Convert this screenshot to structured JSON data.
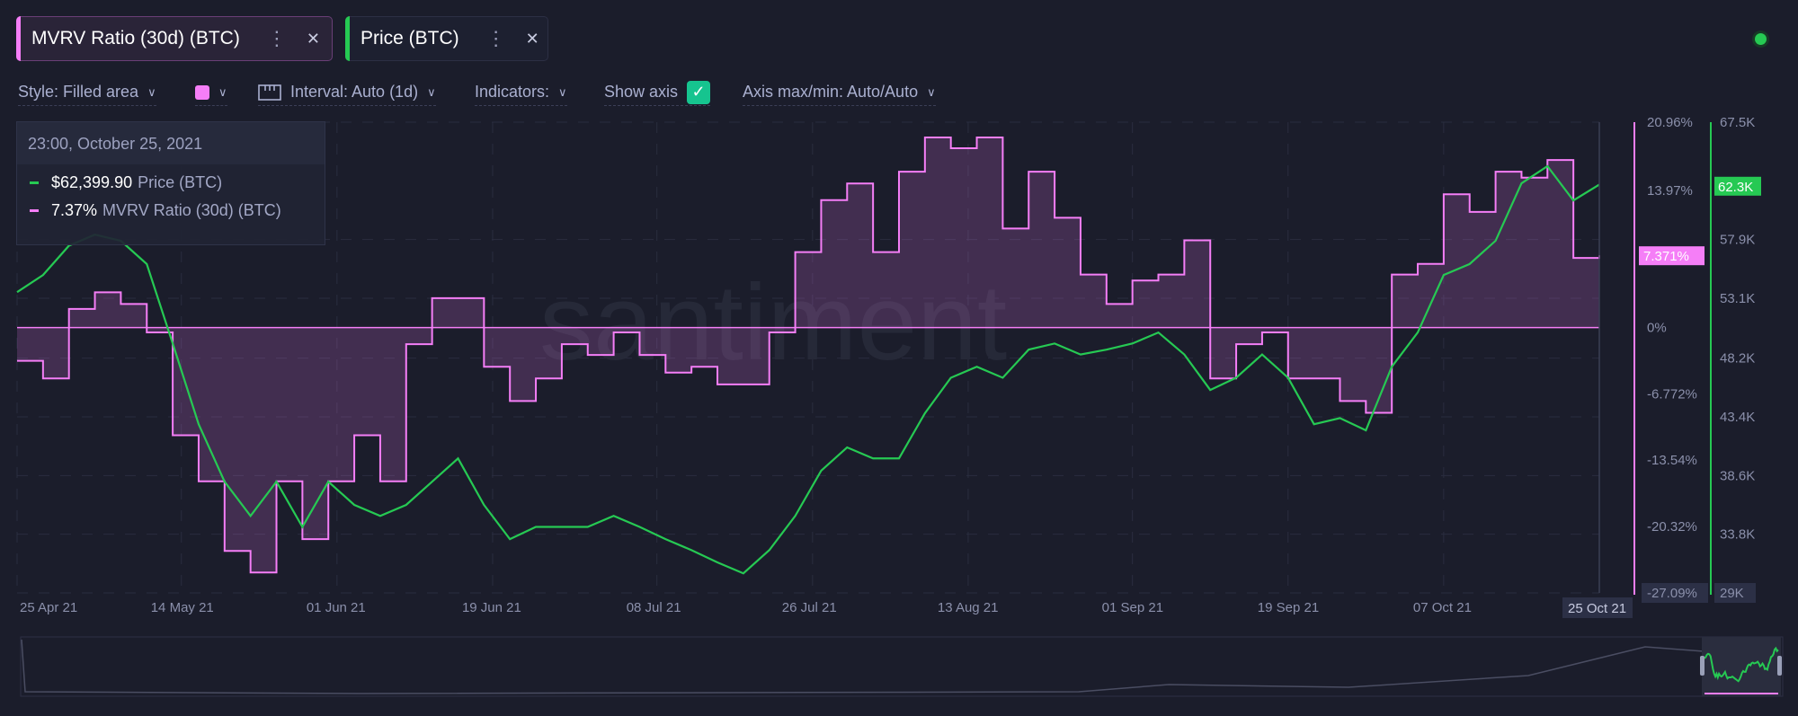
{
  "tabs": [
    {
      "label": "MVRV Ratio (30d) (BTC)",
      "color": "#f57ef7"
    },
    {
      "label": "Price (BTC)",
      "color": "#26c953"
    }
  ],
  "toolbar": {
    "style": "Style: Filled area",
    "interval": "Interval: Auto (1d)",
    "indicators": "Indicators:",
    "show_axis": "Show axis",
    "show_axis_checked": true,
    "axis_maxmin": "Axis max/min: Auto/Auto",
    "series_color": "#f57ef7"
  },
  "tooltip": {
    "date": "23:00, October 25, 2021",
    "rows": [
      {
        "value": "$62,399.90",
        "name": "Price (BTC)",
        "color": "#26c953"
      },
      {
        "value": "7.37%",
        "name": "MVRV Ratio (30d) (BTC)",
        "color": "#f57ef7"
      }
    ]
  },
  "watermark": "santiment",
  "chart_data": {
    "type": "line",
    "start_date": "2021-04-25",
    "step_days": 3,
    "series": [
      {
        "name": "MVRV Ratio (30d) (BTC)",
        "style": "filled-area-step",
        "color": "#f57ef7",
        "unit": "%",
        "values": [
          -3.4,
          -5.2,
          1.9,
          3.6,
          2.4,
          -0.5,
          -11,
          -15.7,
          -22.8,
          -25,
          -15.7,
          -21.6,
          -15.7,
          -11,
          -15.7,
          -1.7,
          3,
          3,
          -4,
          -7.5,
          -5.2,
          -1.7,
          -2.8,
          -0.5,
          -2.8,
          -4.6,
          -4,
          -5.8,
          -5.8,
          -0.5,
          7.7,
          13,
          14.7,
          7.7,
          15.9,
          19.4,
          18.3,
          19.4,
          10.1,
          15.9,
          11.2,
          5.4,
          2.4,
          4.8,
          5.4,
          8.9,
          -5.2,
          -1.7,
          -0.5,
          -5.2,
          -5.2,
          -7.5,
          -8.7,
          5.4,
          6.5,
          13.6,
          11.8,
          15.9,
          15.3,
          17.1,
          7.1,
          7.37
        ]
      },
      {
        "name": "Price (BTC)",
        "style": "line",
        "color": "#26c953",
        "unit": "USD K",
        "values": [
          53.6,
          55.0,
          57.4,
          58.3,
          57.8,
          55.9,
          49.4,
          42.8,
          38.1,
          35.3,
          38.1,
          34.4,
          38.1,
          36.2,
          35.3,
          36.2,
          38.1,
          40.0,
          36.2,
          33.4,
          34.4,
          34.4,
          34.4,
          35.3,
          34.4,
          33.4,
          32.5,
          31.5,
          30.6,
          32.5,
          35.3,
          39.0,
          40.9,
          40.0,
          40.0,
          43.7,
          46.6,
          47.5,
          46.6,
          48.9,
          49.4,
          48.5,
          48.9,
          49.4,
          50.3,
          48.5,
          45.6,
          46.6,
          48.5,
          46.6,
          42.8,
          43.3,
          42.3,
          47.5,
          50.3,
          55.0,
          55.9,
          57.8,
          62.5,
          63.9,
          61.1,
          62.4
        ]
      }
    ],
    "x_ticks": [
      {
        "label": "25 Apr 21",
        "day": 0
      },
      {
        "label": "14 May 21",
        "day": 19
      },
      {
        "label": "01 Jun 21",
        "day": 37
      },
      {
        "label": "19 Jun 21",
        "day": 55
      },
      {
        "label": "08 Jul 21",
        "day": 74
      },
      {
        "label": "26 Jul 21",
        "day": 92
      },
      {
        "label": "13 Aug 21",
        "day": 110
      },
      {
        "label": "01 Sep 21",
        "day": 129
      },
      {
        "label": "19 Sep 21",
        "day": 147
      },
      {
        "label": "07 Oct 21",
        "day": 165
      }
    ],
    "x_cursor": {
      "label": "25 Oct 21",
      "day": 183
    },
    "y_left": {
      "range": [
        -27.09,
        20.96
      ],
      "ticks": [
        {
          "label": "20.96%",
          "v": 20.96
        },
        {
          "label": "13.97%",
          "v": 13.97
        },
        {
          "label": "0%",
          "v": 0
        },
        {
          "label": "-6.772%",
          "v": -6.772
        },
        {
          "label": "-13.54%",
          "v": -13.54
        },
        {
          "label": "-20.32%",
          "v": -20.32
        },
        {
          "label": "-27.09%",
          "v": -27.09
        }
      ],
      "current": {
        "label": "7.371%",
        "v": 7.371
      }
    },
    "y_right": {
      "range": [
        29,
        67.5
      ],
      "ticks": [
        {
          "label": "67.5K",
          "v": 67.5
        },
        {
          "label": "57.9K",
          "v": 57.9
        },
        {
          "label": "53.1K",
          "v": 53.1
        },
        {
          "label": "48.2K",
          "v": 48.2
        },
        {
          "label": "43.4K",
          "v": 43.4
        },
        {
          "label": "38.6K",
          "v": 38.6
        },
        {
          "label": "33.8K",
          "v": 33.8
        },
        {
          "label": "29K",
          "v": 29
        }
      ],
      "current": {
        "label": "62.3K",
        "v": 62.3
      }
    }
  }
}
